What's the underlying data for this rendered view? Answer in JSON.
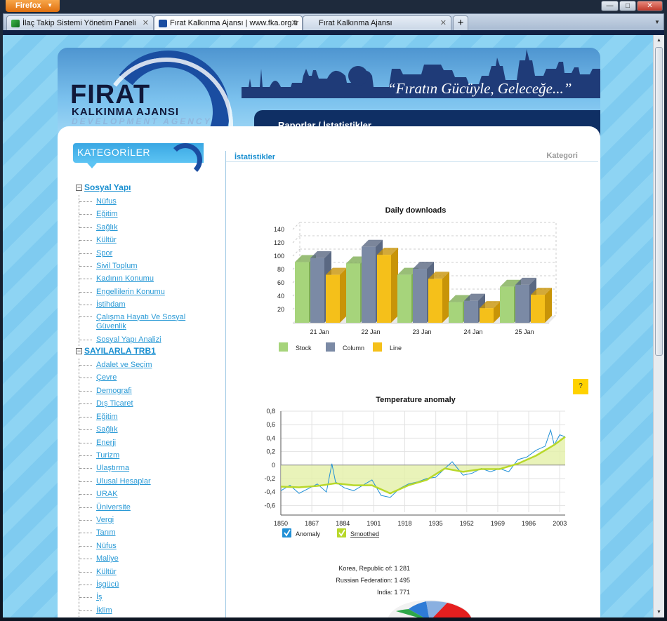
{
  "browser": {
    "app_button": "Firefox",
    "tabs": [
      {
        "title": "İlaç Takip Sistemi Yönetim Paneli",
        "active": false
      },
      {
        "title": "Fırat Kalkınma Ajansı | www.fka.org.tr",
        "active": true
      },
      {
        "title": "Fırat Kalkınma Ajansı",
        "active": false
      }
    ],
    "window_controls": {
      "minimize": "—",
      "maximize": "□",
      "close": "✕"
    },
    "new_tab": "+"
  },
  "header": {
    "logo_title": "FIRAT",
    "logo_subtitle": "KALKINMA AJANSI",
    "logo_subtitle2": "DEVELOPMENT AGENCY",
    "slogan": "“Fıratın Gücüyle, Geleceğe...”",
    "nav_title": "Raporlar / İstatistikler"
  },
  "sidebar": {
    "heading": "KATEGORİLER",
    "groups": [
      {
        "label": "Sosyal Yapı",
        "items": [
          "Nüfus",
          "Eğitim",
          "Sağlık",
          "Kültür",
          "Spor",
          "Sivil Toplum",
          "Kadının Konumu",
          "Engellilerin Konumu",
          "İstihdam",
          "Çalışma Hayatı Ve Sosyal Güvenlik",
          "Sosyal Yapı Analizi"
        ]
      },
      {
        "label": "SAYILARLA TRB1",
        "items": [
          "Adalet ve Seçim",
          "Çevre",
          "Demografi",
          "Dış Ticaret",
          "Eğitim",
          "Sağlık",
          "Enerji",
          "Turizm",
          "Ulaştırma",
          "Ulusal Hesaplar",
          "URAK",
          "Üniversite",
          "Vergi",
          "Tarım",
          "Nüfus",
          "Maliye",
          "Kültür",
          "İşgücü",
          "İş",
          "İklim"
        ]
      }
    ]
  },
  "main": {
    "tab_active": "İstatistikler",
    "tab_other": "Kategori",
    "help_label": "?"
  },
  "colors": {
    "stock": "#a6d47b",
    "column": "#7b8aa5",
    "line": "#f5c01a",
    "anomaly": "#2190d6",
    "smoothed": "#b8d82a"
  },
  "chart_data": [
    {
      "type": "bar",
      "title": "Daily downloads",
      "categories": [
        "21 Jan",
        "22 Jan",
        "23 Jan",
        "24 Jan",
        "25 Jan"
      ],
      "series": [
        {
          "name": "Stock",
          "values": [
            91,
            89,
            72,
            31,
            54
          ]
        },
        {
          "name": "Column",
          "values": [
            97,
            114,
            81,
            33,
            57
          ]
        },
        {
          "name": "Line",
          "values": [
            72,
            102,
            66,
            22,
            42
          ]
        }
      ],
      "y_ticks": [
        20,
        40,
        60,
        80,
        100,
        120,
        140
      ],
      "ylim": [
        0,
        140
      ],
      "legend": "bottom-left",
      "grid": true
    },
    {
      "type": "line",
      "title": "Temperature anomaly",
      "x_ticks": [
        1850,
        1867,
        1884,
        1901,
        1918,
        1935,
        1952,
        1969,
        1986,
        2003
      ],
      "y_ticks": [
        "-0,6",
        "-0,4",
        "-0,2",
        "0",
        "0,2",
        "0,4",
        "0,6",
        "0,8"
      ],
      "ylim": [
        -0.7,
        0.8
      ],
      "xlim": [
        1850,
        2006
      ],
      "series": [
        {
          "name": "Anomaly",
          "x": [
            1850,
            1855,
            1860,
            1865,
            1870,
            1875,
            1878,
            1880,
            1885,
            1890,
            1895,
            1900,
            1905,
            1910,
            1915,
            1920,
            1925,
            1930,
            1935,
            1940,
            1944,
            1950,
            1955,
            1960,
            1965,
            1970,
            1975,
            1980,
            1985,
            1990,
            1995,
            1998,
            2000,
            2003,
            2006
          ],
          "values": [
            -0.38,
            -0.3,
            -0.42,
            -0.35,
            -0.28,
            -0.4,
            0.02,
            -0.25,
            -0.34,
            -0.38,
            -0.3,
            -0.22,
            -0.45,
            -0.48,
            -0.35,
            -0.28,
            -0.25,
            -0.2,
            -0.18,
            -0.05,
            0.05,
            -0.15,
            -0.12,
            -0.05,
            -0.1,
            -0.05,
            -0.1,
            0.08,
            0.12,
            0.22,
            0.28,
            0.52,
            0.3,
            0.45,
            0.42
          ]
        },
        {
          "name": "Smoothed",
          "x": [
            1850,
            1860,
            1870,
            1880,
            1890,
            1900,
            1910,
            1920,
            1930,
            1940,
            1950,
            1960,
            1970,
            1980,
            1990,
            2000,
            2006
          ],
          "values": [
            -0.32,
            -0.33,
            -0.31,
            -0.27,
            -0.3,
            -0.3,
            -0.42,
            -0.3,
            -0.22,
            -0.05,
            -0.1,
            -0.06,
            -0.06,
            0.02,
            0.14,
            0.3,
            0.42
          ]
        }
      ],
      "legend": "bottom-left",
      "grid": true
    },
    {
      "type": "pie",
      "labels": [
        "Korea, Republic of: 1 281",
        "Russian Federation: 1 495",
        "India: 1 771"
      ]
    }
  ]
}
